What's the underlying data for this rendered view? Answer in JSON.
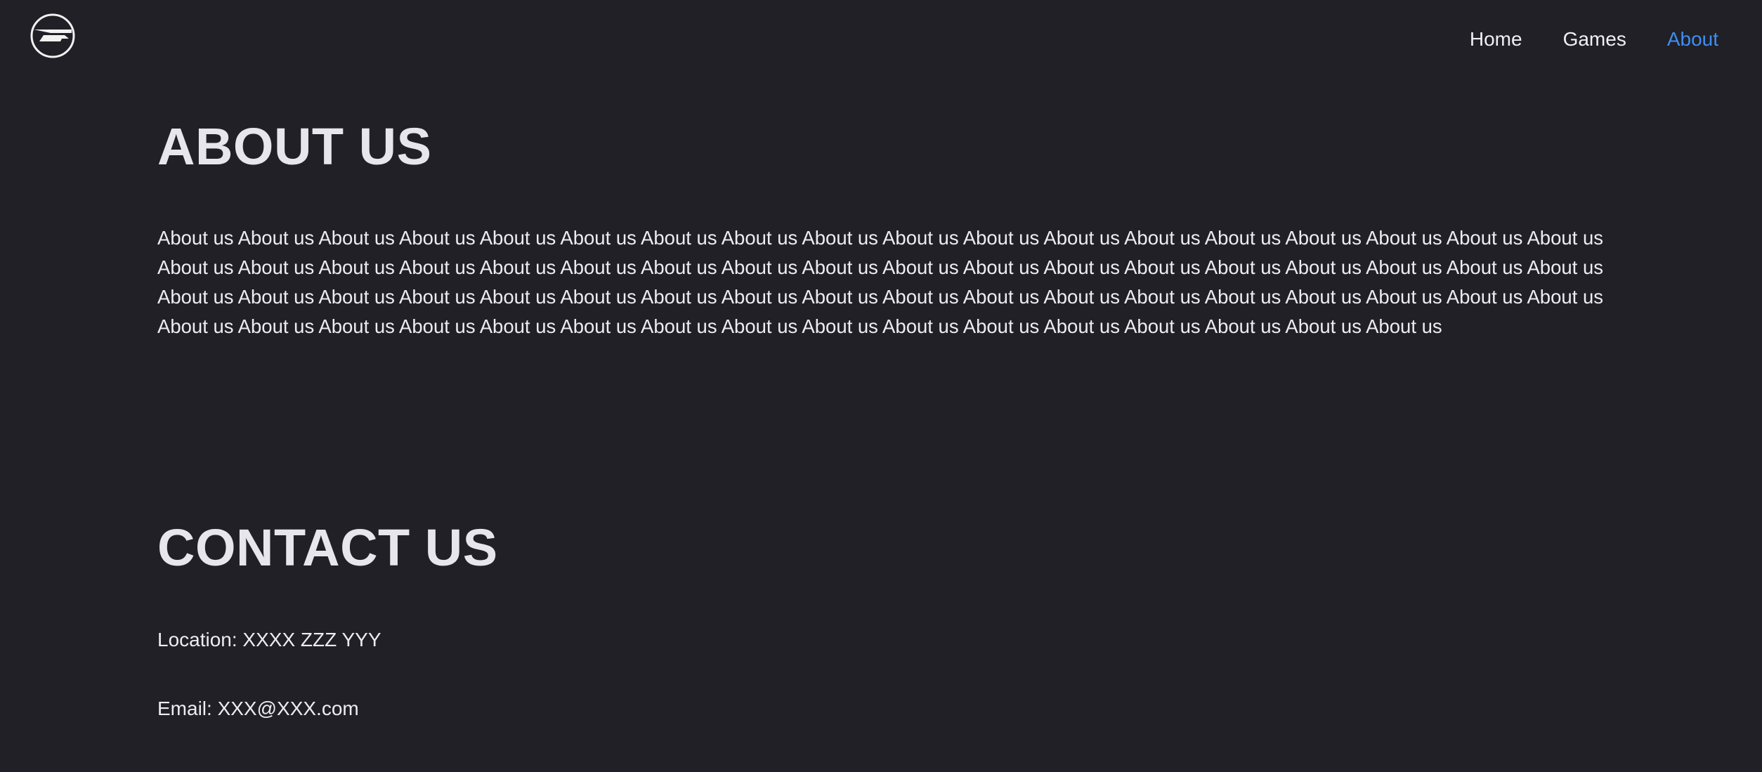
{
  "brand": {
    "logo_icon": "circle-speed-logo-icon"
  },
  "nav": {
    "items": [
      {
        "label": "Home",
        "active": false
      },
      {
        "label": "Games",
        "active": false
      },
      {
        "label": "About",
        "active": true
      }
    ],
    "active_color": "#3f8ef0"
  },
  "about": {
    "title": "ABOUT US",
    "text": "About us About us About us About us About us About us About us About us About us About us About us About us About us About us About us About us About us About us About us About us About us About us About us About us About us About us About us About us About us About us About us About us About us About us About us About us About us About us About us About us About us About us About us About us About us About us About us About us About us About us About us About us About us About us About us About us About us About us About us About us About us About us About us About us About us About us About us About us About us About us"
  },
  "contact": {
    "title": "CONTACT US",
    "location": "Location: XXXX ZZZ YYY",
    "email": "Email: XXX@XXX.com"
  },
  "colors": {
    "background": "#202026",
    "text": "#ececf2"
  }
}
